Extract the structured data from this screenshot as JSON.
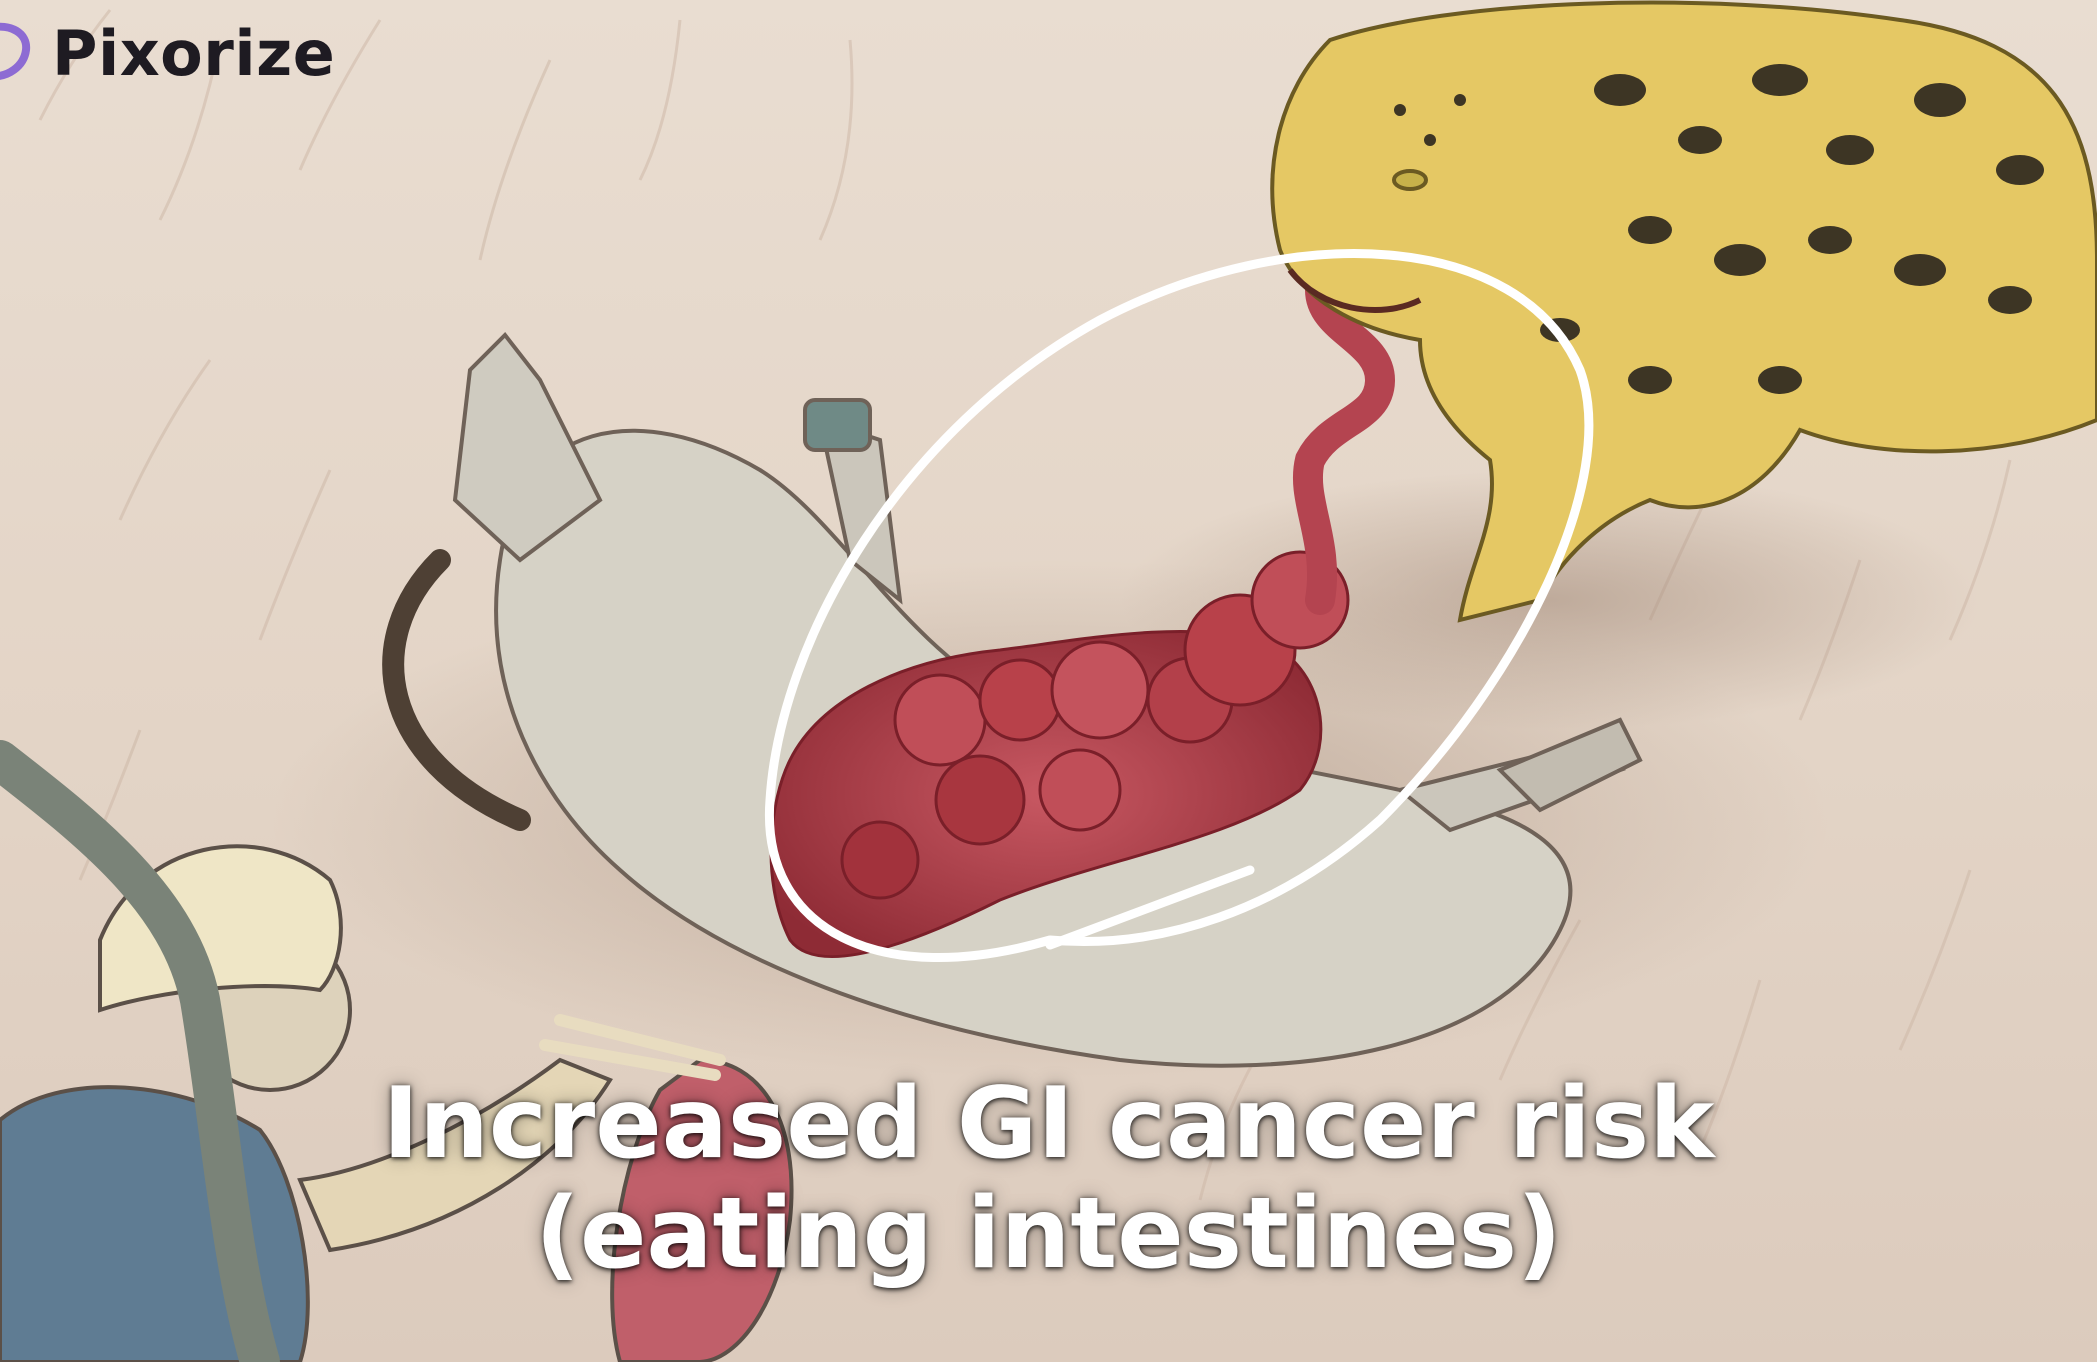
{
  "brand": {
    "name": "Pixorize",
    "logo_icon": "pixorize-logo-icon",
    "logo_color": "#8d6bd3"
  },
  "caption": {
    "line1": "Increased GI cancer risk",
    "line2": "(eating intestines)"
  },
  "scene": {
    "background_color": "#e6d8cb",
    "highlight_color": "#ffffff",
    "intestine_color": "#b8414a",
    "leopard_color": "#e5c864"
  }
}
